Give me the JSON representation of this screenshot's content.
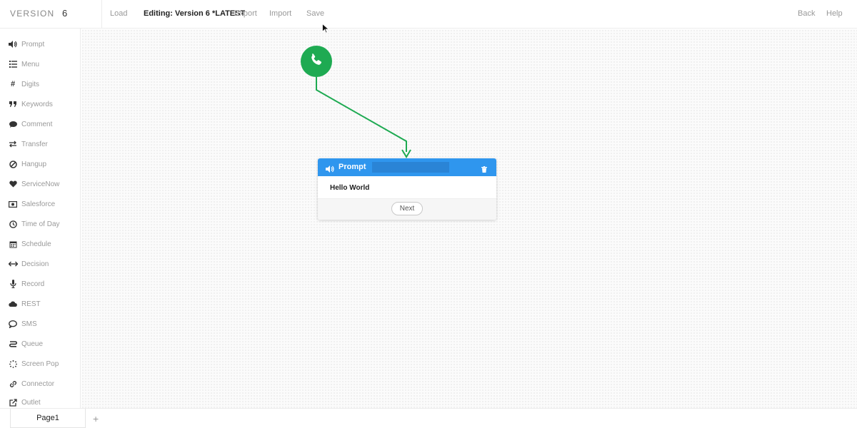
{
  "topbar": {
    "version_label": "VERSION",
    "version_value": "6",
    "load": "Load",
    "editing": "Editing: Version 6 *LATEST",
    "export": "Export",
    "import": "Import",
    "save": "Save",
    "back": "Back",
    "help": "Help"
  },
  "sidebar": {
    "items": [
      {
        "label": "Prompt",
        "icon": "speaker-icon"
      },
      {
        "label": "Menu",
        "icon": "list-icon"
      },
      {
        "label": "Digits",
        "icon": "hash-icon"
      },
      {
        "label": "Keywords",
        "icon": "quote-icon"
      },
      {
        "label": "Comment",
        "icon": "comment-icon"
      },
      {
        "label": "Transfer",
        "icon": "transfer-icon"
      },
      {
        "label": "Hangup",
        "icon": "ban-icon"
      },
      {
        "label": "ServiceNow",
        "icon": "heart-icon"
      },
      {
        "label": "Salesforce",
        "icon": "money-icon"
      },
      {
        "label": "Time of Day",
        "icon": "clock-icon"
      },
      {
        "label": "Schedule",
        "icon": "calendar-icon"
      },
      {
        "label": "Decision",
        "icon": "arrows-h-icon"
      },
      {
        "label": "Record",
        "icon": "microphone-icon"
      },
      {
        "label": "REST",
        "icon": "cloud-icon"
      },
      {
        "label": "SMS",
        "icon": "chat-bubble-icon"
      },
      {
        "label": "Queue",
        "icon": "queue-icon"
      },
      {
        "label": "Screen Pop",
        "icon": "spinner-icon"
      },
      {
        "label": "Connector",
        "icon": "link-icon"
      },
      {
        "label": "Outlet",
        "icon": "share-icon"
      }
    ]
  },
  "canvas": {
    "start_icon": "phone-icon",
    "prompt_node": {
      "title": "Prompt",
      "name_value": "",
      "text": "Hello World",
      "next_label": "Next"
    }
  },
  "pages": {
    "tabs": [
      {
        "label": "Page1"
      }
    ],
    "add_label": "+"
  },
  "colors": {
    "accent_blue": "#2f96ee",
    "start_green": "#1eaa52"
  }
}
